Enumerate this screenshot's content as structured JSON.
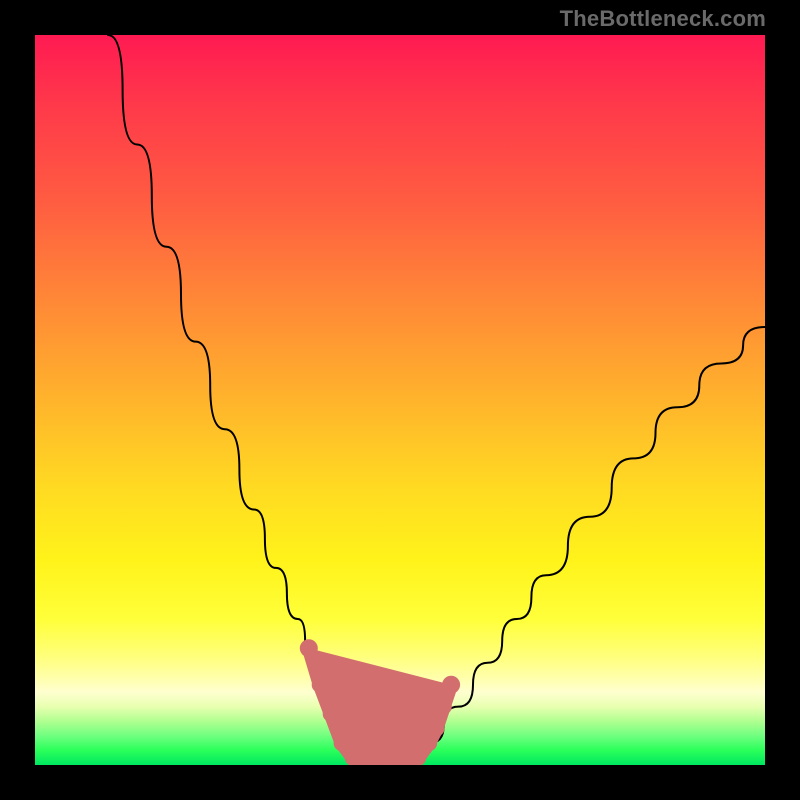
{
  "watermark": "TheBottleneck.com",
  "colors": {
    "background": "#000000",
    "gradient_top": "#ff1a52",
    "gradient_bottom": "#00e860",
    "curve": "#000000",
    "markers": "#d36e6e",
    "watermark": "#6a6a6a"
  },
  "chart_data": {
    "type": "line",
    "title": "",
    "xlabel": "",
    "ylabel": "",
    "xlim": [
      0,
      100
    ],
    "ylim": [
      0,
      100
    ],
    "grid": false,
    "legend": false,
    "series": [
      {
        "name": "bottleneck-curve",
        "x": [
          10,
          14,
          18,
          22,
          26,
          30,
          33,
          36,
          38,
          40,
          42,
          44,
          46,
          50,
          54,
          58,
          62,
          66,
          70,
          76,
          82,
          88,
          94,
          100
        ],
        "values": [
          100,
          85,
          71,
          58,
          46,
          35,
          27,
          20,
          14,
          9,
          5,
          2,
          0,
          0,
          3,
          8,
          14,
          20,
          26,
          34,
          42,
          49,
          55,
          60
        ]
      }
    ],
    "markers": [
      {
        "x": 37.5,
        "y": 16
      },
      {
        "x": 39.0,
        "y": 11
      },
      {
        "x": 40.5,
        "y": 7
      },
      {
        "x": 42.0,
        "y": 3
      },
      {
        "x": 43.5,
        "y": 1
      },
      {
        "x": 45.0,
        "y": 0
      },
      {
        "x": 47.0,
        "y": 0
      },
      {
        "x": 49.0,
        "y": 0
      },
      {
        "x": 51.0,
        "y": 0
      },
      {
        "x": 52.5,
        "y": 1
      },
      {
        "x": 54.0,
        "y": 3
      },
      {
        "x": 55.0,
        "y": 5
      },
      {
        "x": 56.0,
        "y": 8
      },
      {
        "x": 57.0,
        "y": 11
      }
    ]
  }
}
